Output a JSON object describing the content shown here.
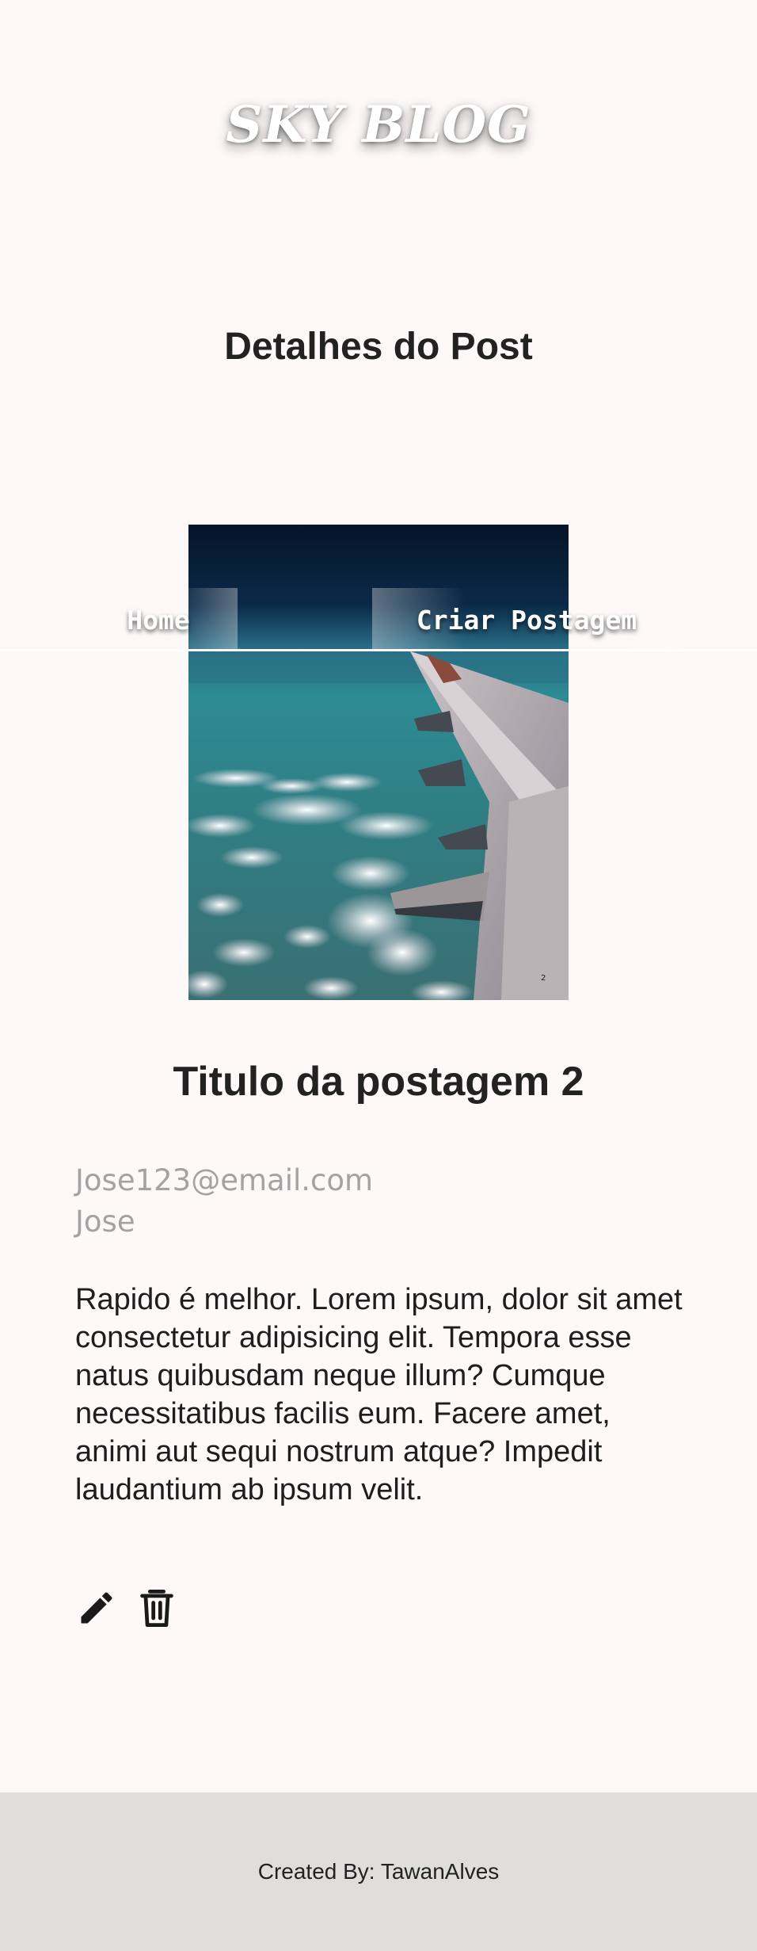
{
  "header": {
    "logo_text": "SKY BLOG"
  },
  "page_title": "Detalhes do Post",
  "nav": {
    "items": [
      {
        "label": "Home"
      },
      {
        "label": "Criar Postagem"
      }
    ]
  },
  "post": {
    "title": "Titulo da postagem 2",
    "author_email": "Jose123@email.com",
    "author_name": "Jose",
    "body": "Rapido é melhor. Lorem ipsum, dolor sit amet consectetur adipisicing elit. Tempora esse natus quibusdam neque illum? Cumque necessitatibus facilis eum. Facere amet, animi aut sequi nostrum atque? Impedit laudantium ab ipsum velit.",
    "image_icon": "airplane-wing-over-clouds-image"
  },
  "actions": {
    "edit_icon": "pencil-icon",
    "delete_icon": "trash-icon"
  },
  "footer": {
    "credit": "Created By: TawanAlves"
  },
  "colors": {
    "background": "#fcf9f8",
    "footer_bg": "#dfdedd",
    "meta_text": "#a3a3a3",
    "text": "#222222"
  }
}
